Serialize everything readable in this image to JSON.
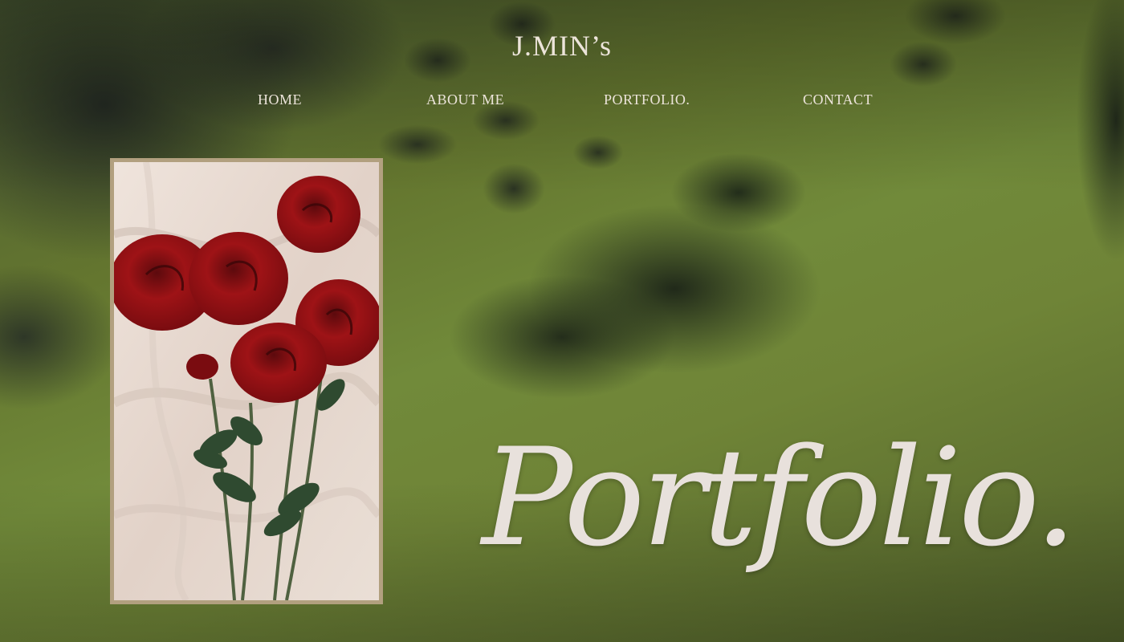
{
  "site": {
    "brand": "J.MIN’s"
  },
  "nav": [
    {
      "label": "HOME"
    },
    {
      "label": "ABOUT ME"
    },
    {
      "label": "PORTFOLIO."
    },
    {
      "label": "CONTACT"
    }
  ],
  "hero": {
    "headline": "Portfolio."
  },
  "colors": {
    "text_cream": "#ece4da",
    "frame_tan": "#b2a07f",
    "grass": "#718a3a",
    "rose_red": "#9e1316"
  }
}
